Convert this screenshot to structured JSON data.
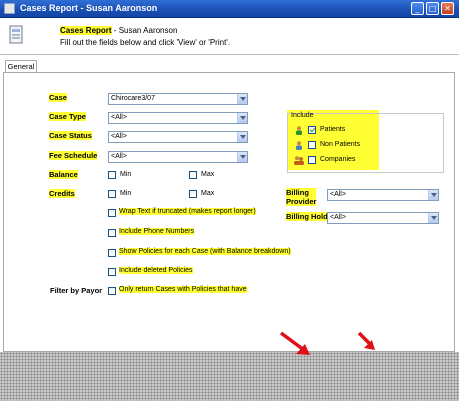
{
  "window": {
    "title": "Cases Report - Susan Aaronson"
  },
  "header": {
    "report_name": "Cases Report",
    "report_suffix": " - Susan Aaronson",
    "instructions": "Fill out the fields below and click 'View' or 'Print'."
  },
  "tabs": [
    {
      "label": "General",
      "selected": true
    }
  ],
  "fields": {
    "case": {
      "label": "Case",
      "value": "Chirocare3/07"
    },
    "case_type": {
      "label": "Case Type",
      "value": "<All>"
    },
    "case_status": {
      "label": "Case Status",
      "value": "<All>"
    },
    "fee_schedule": {
      "label": "Fee Schedule",
      "value": "<All>"
    },
    "balance": {
      "label": "Balance",
      "min_label": "Min",
      "max_label": "Max"
    },
    "credits": {
      "label": "Credits",
      "min_label": "Min",
      "max_label": "Max"
    },
    "billing_provider": {
      "label": "Billing Provider",
      "label_line1": "Billing",
      "label_line2": "Provider",
      "value": "<All>"
    },
    "billing_hold": {
      "label": "Billing Hold",
      "value": "<All>"
    },
    "filter_by_payor": {
      "label": "Filter by Payor"
    }
  },
  "include": {
    "title": "Include",
    "items": [
      {
        "label": "Patients",
        "checked": true,
        "icon": "patient-icon"
      },
      {
        "label": "Non Patients",
        "checked": false,
        "icon": "non-patient-icon"
      },
      {
        "label": "Companies",
        "checked": false,
        "icon": "company-icon"
      }
    ]
  },
  "options": [
    {
      "label": "Wrap Text if truncated (makes report longer)",
      "checked": false
    },
    {
      "label": "Include Phone Numbers",
      "checked": false
    },
    {
      "label": "Show Policies for each Case (with Balance breakdown)",
      "checked": false
    },
    {
      "label": "Include deleted Policies",
      "checked": false
    }
  ],
  "payor_option": {
    "label": "Only return Cases with Policies that have",
    "checked": false
  },
  "colors": {
    "highlight": "#ffff33",
    "titlebar": "#2f6fd6",
    "annotation_arrow": "#e0101a"
  }
}
